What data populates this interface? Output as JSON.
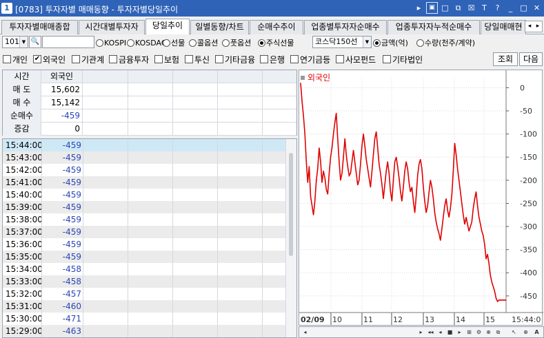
{
  "window": {
    "badge": "1",
    "title": "[0783] 투자자별 매매동향 - 투자자별당일추이",
    "controls": [
      "▸",
      "▣",
      "□",
      "⧉",
      "☒",
      "T",
      "?",
      "_",
      "□",
      "✕"
    ]
  },
  "tabs": [
    {
      "label": "투자자별매매종합",
      "active": false
    },
    {
      "label": "시간대별투자자",
      "active": false
    },
    {
      "label": "당일추이",
      "active": true
    },
    {
      "label": "일별동향/차트",
      "active": false
    },
    {
      "label": "순매수추이",
      "active": false
    },
    {
      "label": "업종별투자자순매수",
      "active": false
    },
    {
      "label": "업종투자자누적순매수",
      "active": false
    },
    {
      "label": "당일매매현",
      "active": false
    }
  ],
  "tab_nav": {
    "prev": "◂",
    "next": "▸"
  },
  "filter": {
    "code_value": "101",
    "code_dropdown": "▼",
    "search_icon": "search-icon",
    "search_glyph": "🔍",
    "markets": [
      {
        "label": "KOSPI",
        "selected": false
      },
      {
        "label": "KOSDAQ",
        "selected": false
      },
      {
        "label": "선물",
        "selected": false
      },
      {
        "label": "콜옵션",
        "selected": false
      },
      {
        "label": "풋옵션",
        "selected": false
      },
      {
        "label": "주식선물",
        "selected": true
      }
    ],
    "sub_select": "코스닥150선",
    "sub_dropdown": "▼",
    "units": [
      {
        "label": "금액(억)",
        "selected": true
      },
      {
        "label": "수량(천주/계약)",
        "selected": false
      }
    ]
  },
  "investors": [
    {
      "label": "개인",
      "checked": false
    },
    {
      "label": "외국인",
      "checked": true
    },
    {
      "label": "기관계",
      "checked": false
    },
    {
      "label": "금융투자",
      "checked": false
    },
    {
      "label": "보험",
      "checked": false
    },
    {
      "label": "투신",
      "checked": false
    },
    {
      "label": "기타금융",
      "checked": false
    },
    {
      "label": "은행",
      "checked": false
    },
    {
      "label": "연기금등",
      "checked": false
    },
    {
      "label": "사모펀드",
      "checked": false
    },
    {
      "label": "기타법인",
      "checked": false
    }
  ],
  "check_mark": "✔",
  "buttons": {
    "query": "조회",
    "next": "다음"
  },
  "summary": {
    "headers": [
      "시간",
      "외국인"
    ],
    "rows": [
      {
        "label": "매 도",
        "value": "15,602",
        "negative": false
      },
      {
        "label": "매 수",
        "value": "15,142",
        "negative": false
      },
      {
        "label": "순매수",
        "value": "-459",
        "negative": true
      },
      {
        "label": "증감",
        "value": "0",
        "negative": false
      }
    ]
  },
  "time_rows": [
    {
      "time": "15:44:00",
      "value": "-459"
    },
    {
      "time": "15:43:00",
      "value": "-459"
    },
    {
      "time": "15:42:00",
      "value": "-459"
    },
    {
      "time": "15:41:00",
      "value": "-459"
    },
    {
      "time": "15:40:00",
      "value": "-459"
    },
    {
      "time": "15:39:00",
      "value": "-459"
    },
    {
      "time": "15:38:00",
      "value": "-459"
    },
    {
      "time": "15:37:00",
      "value": "-459"
    },
    {
      "time": "15:36:00",
      "value": "-459"
    },
    {
      "time": "15:35:00",
      "value": "-459"
    },
    {
      "time": "15:34:00",
      "value": "-458"
    },
    {
      "time": "15:33:00",
      "value": "-458"
    },
    {
      "time": "15:32:00",
      "value": "-457"
    },
    {
      "time": "15:31:00",
      "value": "-460"
    },
    {
      "time": "15:30:00",
      "value": "-471"
    },
    {
      "time": "15:29:00",
      "value": "-463"
    }
  ],
  "chart_data": {
    "type": "line",
    "series": [
      {
        "name": "외국인",
        "color": "#e00000",
        "values": [
          [
            0,
            10
          ],
          [
            1,
            -30
          ],
          [
            2,
            -60
          ],
          [
            3,
            -100
          ],
          [
            4,
            -160
          ],
          [
            5,
            -205
          ],
          [
            6,
            -170
          ],
          [
            7,
            -235
          ],
          [
            8,
            -255
          ],
          [
            9,
            -275
          ],
          [
            10,
            -245
          ],
          [
            11,
            -200
          ],
          [
            12,
            -175
          ],
          [
            13,
            -130
          ],
          [
            14,
            -160
          ],
          [
            15,
            -205
          ],
          [
            16,
            -180
          ],
          [
            17,
            -195
          ],
          [
            18,
            -220
          ],
          [
            19,
            -230
          ],
          [
            20,
            -185
          ],
          [
            21,
            -150
          ],
          [
            22,
            -130
          ],
          [
            23,
            -100
          ],
          [
            24,
            -75
          ],
          [
            25,
            -55
          ],
          [
            26,
            -110
          ],
          [
            27,
            -160
          ],
          [
            28,
            -200
          ],
          [
            29,
            -185
          ],
          [
            30,
            -150
          ],
          [
            31,
            -110
          ],
          [
            32,
            -145
          ],
          [
            33,
            -170
          ],
          [
            34,
            -190
          ],
          [
            35,
            -185
          ],
          [
            36,
            -160
          ],
          [
            37,
            -135
          ],
          [
            38,
            -160
          ],
          [
            39,
            -185
          ],
          [
            40,
            -210
          ],
          [
            41,
            -200
          ],
          [
            42,
            -165
          ],
          [
            43,
            -125
          ],
          [
            44,
            -100
          ],
          [
            45,
            -125
          ],
          [
            46,
            -155
          ],
          [
            47,
            -175
          ],
          [
            48,
            -195
          ],
          [
            49,
            -215
          ],
          [
            50,
            -180
          ],
          [
            51,
            -145
          ],
          [
            52,
            -110
          ],
          [
            53,
            -95
          ],
          [
            54,
            -130
          ],
          [
            55,
            -165
          ],
          [
            56,
            -185
          ],
          [
            57,
            -210
          ],
          [
            58,
            -240
          ],
          [
            59,
            -210
          ],
          [
            60,
            -180
          ],
          [
            61,
            -160
          ],
          [
            62,
            -185
          ],
          [
            63,
            -225
          ],
          [
            64,
            -245
          ],
          [
            65,
            -200
          ],
          [
            66,
            -160
          ],
          [
            67,
            -150
          ],
          [
            68,
            -170
          ],
          [
            69,
            -195
          ],
          [
            70,
            -225
          ],
          [
            71,
            -245
          ],
          [
            72,
            -215
          ],
          [
            73,
            -180
          ],
          [
            74,
            -160
          ],
          [
            75,
            -175
          ],
          [
            76,
            -205
          ],
          [
            77,
            -225
          ],
          [
            78,
            -215
          ],
          [
            79,
            -245
          ],
          [
            80,
            -270
          ],
          [
            81,
            -235
          ],
          [
            82,
            -190
          ],
          [
            83,
            -165
          ],
          [
            84,
            -155
          ],
          [
            85,
            -175
          ],
          [
            86,
            -215
          ],
          [
            87,
            -245
          ],
          [
            88,
            -270
          ],
          [
            89,
            -255
          ],
          [
            90,
            -225
          ],
          [
            91,
            -200
          ],
          [
            92,
            -215
          ],
          [
            93,
            -240
          ],
          [
            94,
            -270
          ],
          [
            95,
            -290
          ],
          [
            96,
            -305
          ],
          [
            97,
            -315
          ],
          [
            98,
            -330
          ],
          [
            99,
            -305
          ],
          [
            100,
            -280
          ],
          [
            101,
            -255
          ],
          [
            102,
            -240
          ],
          [
            103,
            -265
          ],
          [
            104,
            -280
          ],
          [
            105,
            -260
          ],
          [
            106,
            -230
          ],
          [
            107,
            -180
          ],
          [
            108,
            -120
          ],
          [
            109,
            -145
          ],
          [
            110,
            -175
          ],
          [
            111,
            -200
          ],
          [
            112,
            -225
          ],
          [
            113,
            -250
          ],
          [
            114,
            -275
          ],
          [
            115,
            -295
          ],
          [
            116,
            -280
          ],
          [
            117,
            -295
          ],
          [
            118,
            -310
          ],
          [
            119,
            -300
          ],
          [
            120,
            -290
          ],
          [
            121,
            -260
          ],
          [
            122,
            -240
          ],
          [
            123,
            -225
          ],
          [
            124,
            -255
          ],
          [
            125,
            -280
          ],
          [
            126,
            -295
          ],
          [
            127,
            -310
          ],
          [
            128,
            -320
          ],
          [
            129,
            -340
          ],
          [
            130,
            -370
          ],
          [
            131,
            -360
          ],
          [
            132,
            -380
          ],
          [
            133,
            -405
          ],
          [
            134,
            -420
          ],
          [
            135,
            -430
          ],
          [
            136,
            -440
          ],
          [
            137,
            -455
          ],
          [
            138,
            -462
          ],
          [
            139,
            -459
          ],
          [
            140,
            -459
          ],
          [
            141,
            -459
          ],
          [
            142,
            -459
          ],
          [
            143,
            -459
          ],
          [
            144,
            -459
          ]
        ]
      }
    ],
    "x_tick_labels": [
      "02/09",
      "10",
      "11",
      "12",
      "13",
      "14",
      "15",
      "15:44:0"
    ],
    "y_ticks": [
      0,
      -50,
      -100,
      -150,
      -200,
      -250,
      -300,
      -350,
      -400,
      -450
    ],
    "ylim": [
      20,
      -480
    ],
    "grid": true,
    "legend": "top-left"
  }
}
